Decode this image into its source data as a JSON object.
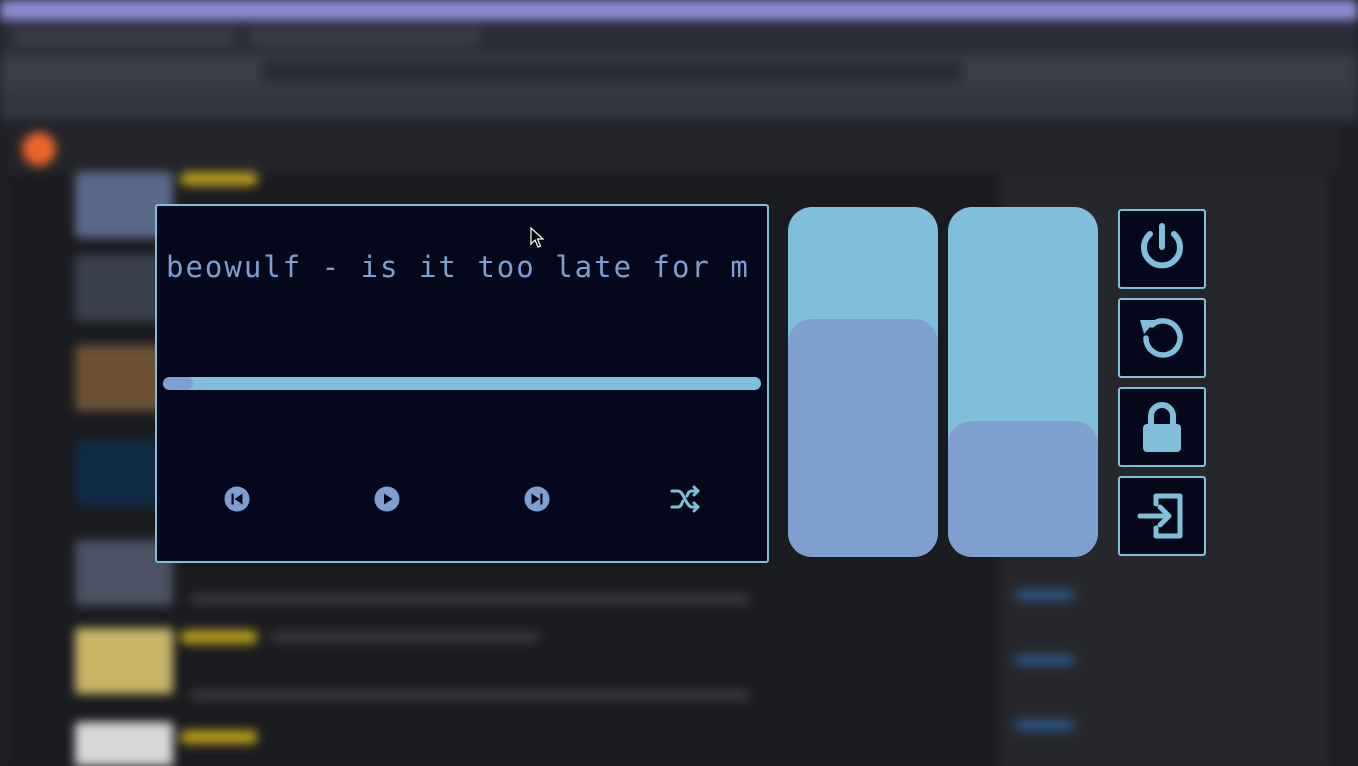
{
  "colors": {
    "panel_bg": "#05081a",
    "accent": "#7fbfd9",
    "fill": "#7f9fd0"
  },
  "player": {
    "title": "beowulf - is it too late for m...",
    "progress": 0.05,
    "controls": [
      {
        "name": "previous-icon",
        "icon": "skip-previous"
      },
      {
        "name": "play-icon",
        "icon": "play"
      },
      {
        "name": "next-icon",
        "icon": "skip-next"
      },
      {
        "name": "shuffle-icon",
        "icon": "shuffle"
      }
    ]
  },
  "sliders": [
    {
      "name": "volume-slider",
      "level": 0.68
    },
    {
      "name": "brightness-slider",
      "level": 0.39
    }
  ],
  "system_buttons": [
    {
      "name": "power-button",
      "icon": "power"
    },
    {
      "name": "restart-button",
      "icon": "restart"
    },
    {
      "name": "lock-button",
      "icon": "lock"
    },
    {
      "name": "logout-button",
      "icon": "logout"
    }
  ]
}
